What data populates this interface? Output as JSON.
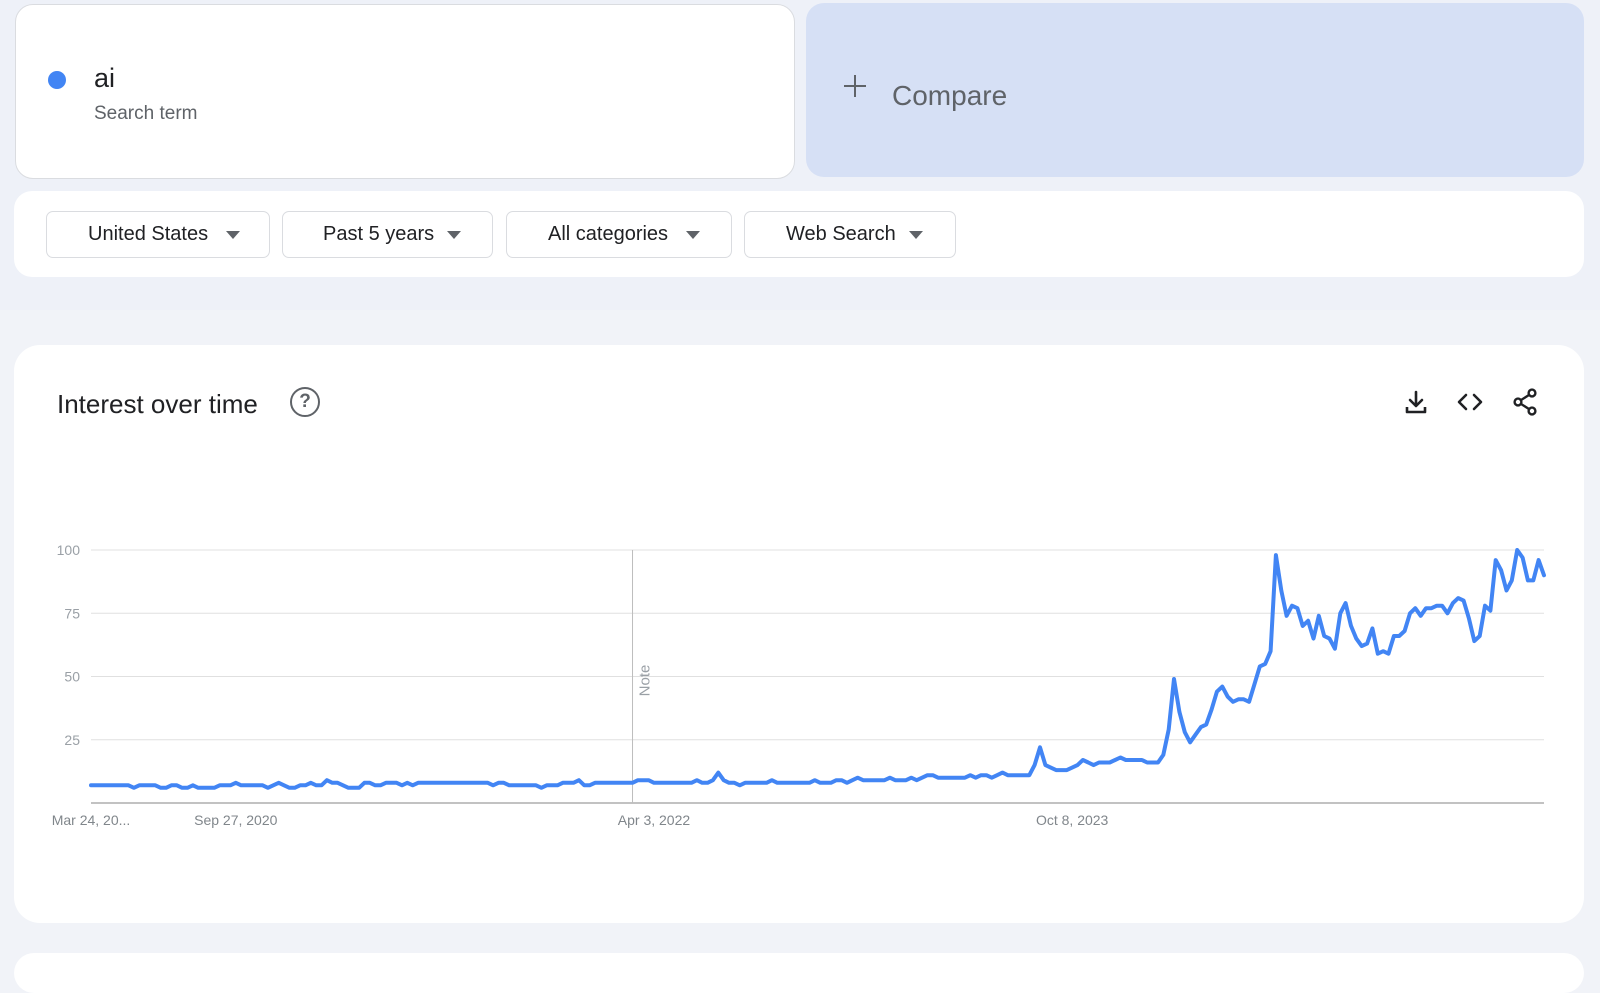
{
  "search_term": {
    "name": "ai",
    "subtitle": "Search term",
    "color": "#4285f4"
  },
  "compare": {
    "label": "Compare",
    "background": "#d6e0f5"
  },
  "filters": [
    {
      "label": "United States"
    },
    {
      "label": "Past 5 years"
    },
    {
      "label": "All categories"
    },
    {
      "label": "Web Search"
    }
  ],
  "chart_card": {
    "title": "Interest over time",
    "help_icon": "help-circle-icon",
    "tools": [
      "download-icon",
      "embed-code-icon",
      "share-icon"
    ]
  },
  "chart_data": {
    "type": "line",
    "title": "",
    "xlabel": "",
    "ylabel": "",
    "ylim": [
      0,
      100
    ],
    "yticks": [
      25,
      50,
      75,
      100
    ],
    "grid": true,
    "x_ticks": [
      {
        "label": "Mar 24, 20...",
        "index": 0
      },
      {
        "label": "Sep 27, 2020",
        "index": 27
      },
      {
        "label": "Apr 3, 2022",
        "index": 105
      },
      {
        "label": "Oct 8, 2023",
        "index": 183
      }
    ],
    "annotation": {
      "label": "Note",
      "index": 101
    },
    "series": [
      {
        "color": "#4285f4",
        "values": [
          7,
          7,
          7,
          7,
          7,
          7,
          7,
          7,
          6,
          7,
          7,
          7,
          7,
          6,
          6,
          7,
          7,
          6,
          6,
          7,
          6,
          6,
          6,
          6,
          7,
          7,
          7,
          8,
          7,
          7,
          7,
          7,
          7,
          6,
          7,
          8,
          7,
          6,
          6,
          7,
          7,
          8,
          7,
          7,
          9,
          8,
          8,
          7,
          6,
          6,
          6,
          8,
          8,
          7,
          7,
          8,
          8,
          8,
          7,
          8,
          7,
          8,
          8,
          8,
          8,
          8,
          8,
          8,
          8,
          8,
          8,
          8,
          8,
          8,
          8,
          7,
          8,
          8,
          7,
          7,
          7,
          7,
          7,
          7,
          6,
          7,
          7,
          7,
          8,
          8,
          8,
          9,
          7,
          7,
          8,
          8,
          8,
          8,
          8,
          8,
          8,
          8,
          9,
          9,
          9,
          8,
          8,
          8,
          8,
          8,
          8,
          8,
          8,
          9,
          8,
          8,
          9,
          12,
          9,
          8,
          8,
          7,
          8,
          8,
          8,
          8,
          8,
          9,
          8,
          8,
          8,
          8,
          8,
          8,
          8,
          9,
          8,
          8,
          8,
          9,
          9,
          8,
          9,
          10,
          9,
          9,
          9,
          9,
          9,
          10,
          9,
          9,
          9,
          10,
          9,
          10,
          11,
          11,
          10,
          10,
          10,
          10,
          10,
          10,
          11,
          10,
          11,
          11,
          10,
          11,
          12,
          11,
          11,
          11,
          11,
          11,
          15,
          22,
          15,
          14,
          13,
          13,
          13,
          14,
          15,
          17,
          16,
          15,
          16,
          16,
          16,
          17,
          18,
          17,
          17,
          17,
          17,
          16,
          16,
          16,
          19,
          29,
          49,
          36,
          28,
          24,
          27,
          30,
          31,
          37,
          44,
          46,
          42,
          40,
          41,
          41,
          40,
          47,
          54,
          55,
          60,
          98,
          84,
          74,
          78,
          77,
          70,
          72,
          65,
          74,
          66,
          65,
          61,
          75,
          79,
          70,
          65,
          62,
          63,
          69,
          59,
          60,
          59,
          66,
          66,
          68,
          75,
          77,
          74,
          77,
          77,
          78,
          78,
          75,
          79,
          81,
          80,
          73,
          64,
          66,
          78,
          76,
          96,
          92,
          84,
          88,
          100,
          97,
          88,
          88,
          96,
          90
        ]
      }
    ]
  }
}
